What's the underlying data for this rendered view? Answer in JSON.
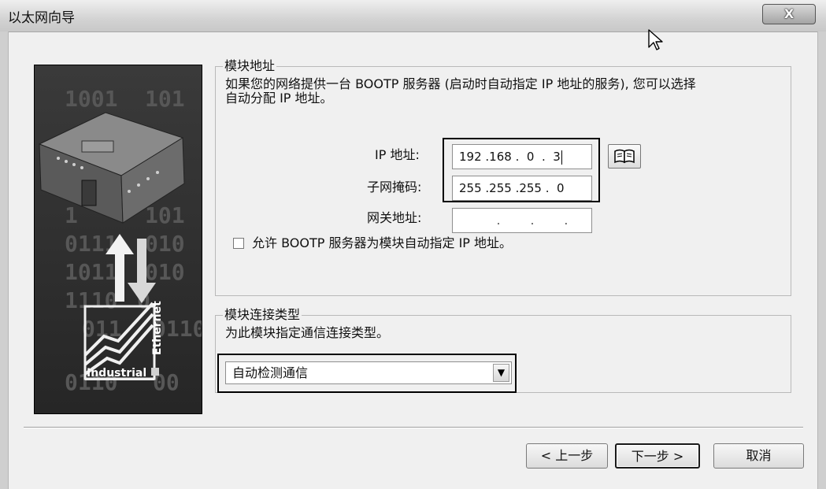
{
  "window": {
    "title": "以太网向导",
    "close_label": "X"
  },
  "side_image": {
    "brand_text": "Industrial",
    "ethernet_text": "Ethernet",
    "binary_rows": [
      "1001",
      "101",
      "1",
      "101",
      "0111",
      "010",
      "1011",
      "010",
      "1110",
      "0",
      "011",
      "011001",
      "0110",
      "00"
    ]
  },
  "module_address": {
    "legend": "模块地址",
    "description_line1": "如果您的网络提供一台 BOOTP 服务器 (启动时自动指定 IP 地址的服务), 您可以选择",
    "description_line2": "自动分配 IP 地址。",
    "ip_label": "IP 地址:",
    "ip_value": "192 .168 .  0  .  3",
    "subnet_label": "子网掩码:",
    "subnet_value": "255 .255 .255 .  0",
    "gateway_label": "网关地址:",
    "gateway_value": "          .        .        .",
    "bootp_checkbox_label": "允许 BOOTP 服务器为模块自动指定 IP 地址。"
  },
  "connection_type": {
    "legend": "模块连接类型",
    "description": "为此模块指定通信连接类型。",
    "selected_option": "自动检测通信",
    "dropdown_arrow": "▼"
  },
  "buttons": {
    "back": "< 上一步",
    "next": "下一步 >",
    "cancel": "取消"
  },
  "icons": {
    "book": "book-icon",
    "cursor": "mouse-cursor-icon"
  }
}
